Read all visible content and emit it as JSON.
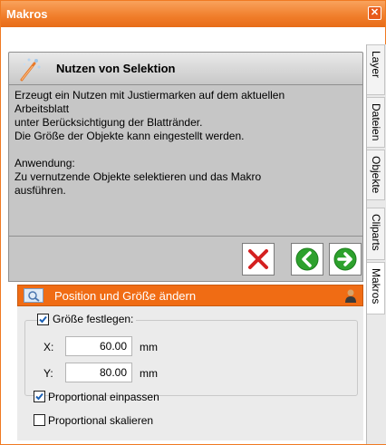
{
  "window": {
    "title": "Makros",
    "close_label": "✕"
  },
  "side_tabs": [
    {
      "label": "Layer"
    },
    {
      "label": "Dateien"
    },
    {
      "label": "Objekte"
    },
    {
      "label": "Cliparts"
    },
    {
      "label": "Makros",
      "active": true
    }
  ],
  "macro": {
    "title": "Nutzen von Selektion",
    "description_lines": [
      "Erzeugt ein Nutzen mit Justiermarken auf dem aktuellen",
      "Arbeitsblatt",
      "unter Berücksichtigung der Blattränder.",
      "Die Größe der Objekte kann eingestellt werden.",
      "",
      "Anwendung:",
      "Zu vernutzende Objekte selektieren und das Makro",
      "ausführen."
    ]
  },
  "actions": {
    "cancel_icon": "red-x-icon",
    "back_icon": "green-left-arrow-icon",
    "forward_icon": "green-right-arrow-icon"
  },
  "section": {
    "title": "Position und Größe ändern",
    "group_label": "Größe festlegen:",
    "group_checked": true,
    "x_label": "X:",
    "x_value": "60.00",
    "x_unit": "mm",
    "y_label": "Y:",
    "y_value": "80.00",
    "y_unit": "mm",
    "proportional_fit_label": "Proportional einpassen",
    "proportional_fit_checked": true,
    "proportional_scale_label": "Proportional skalieren",
    "proportional_scale_checked": false
  },
  "colors": {
    "accent": "#f06c14",
    "title_bar": "#f07d2a",
    "header_gray": "#c6c6c6",
    "green_button": "#2da12d",
    "cancel_red": "#d42020"
  }
}
